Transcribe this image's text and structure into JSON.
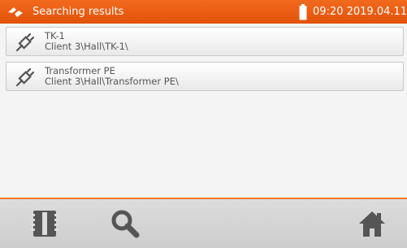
{
  "header": {
    "logo_icon": "sonel-logo-icon",
    "title": "Searching results",
    "battery_icon": "battery-icon",
    "time": "09:20",
    "date": "2019.04.11"
  },
  "results": [
    {
      "icon": "connector-plug-icon",
      "name": "TK-1",
      "path": "Client 3\\Hall\\TK-1\\"
    },
    {
      "icon": "connector-plug-icon",
      "name": "Transformer PE",
      "path": "Client 3\\Hall\\Transformer PE\\"
    }
  ],
  "footer": {
    "buttons": [
      {
        "icon": "memory-card-icon"
      },
      {
        "icon": "search-icon"
      },
      {
        "icon": "home-icon"
      }
    ]
  },
  "colors": {
    "accent": "#ec5f12",
    "header_text": "#ffffff",
    "footer_icon": "#555555"
  }
}
